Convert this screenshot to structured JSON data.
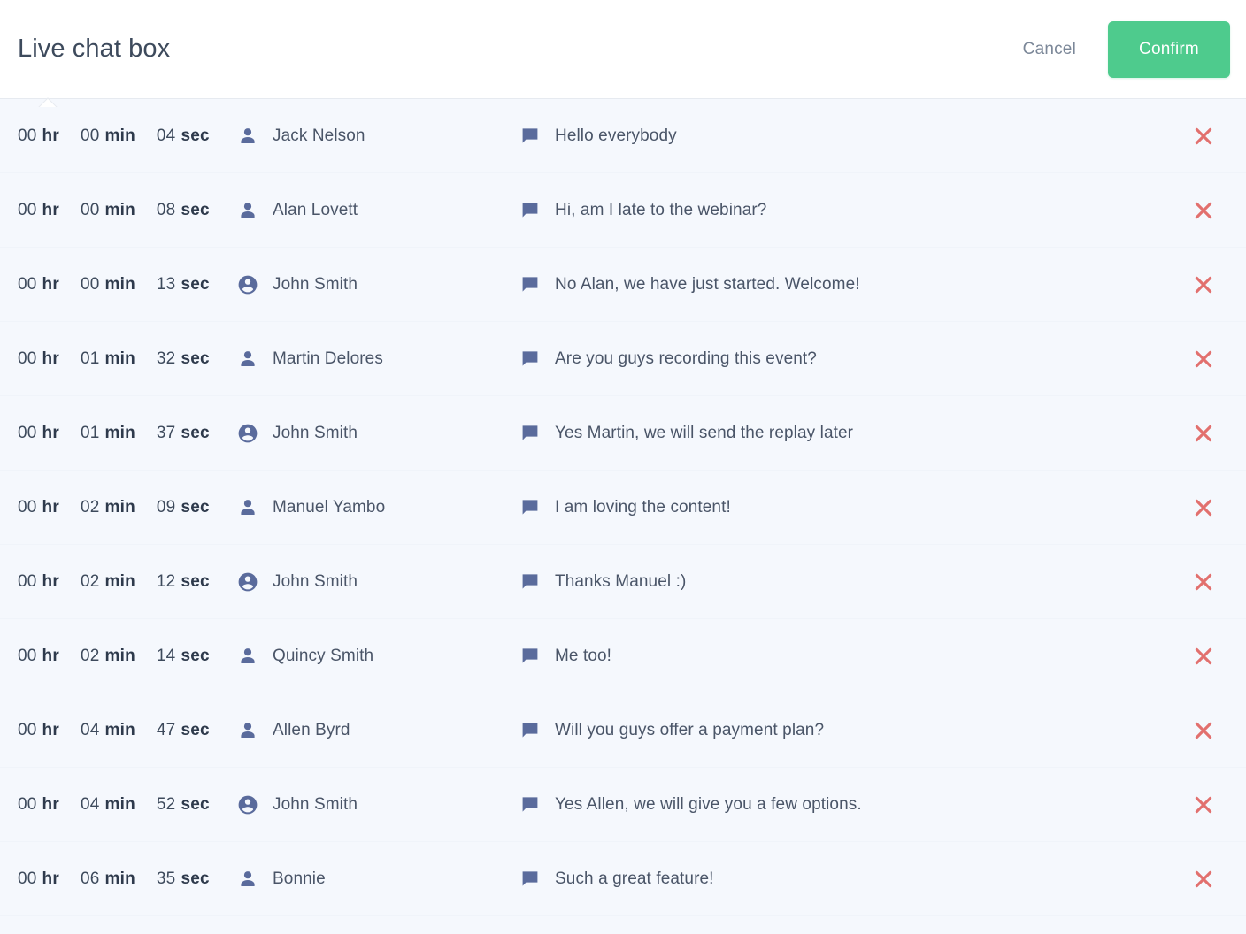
{
  "header": {
    "title": "Live chat box",
    "cancel_label": "Cancel",
    "confirm_label": "Confirm",
    "notch_icon": "caret-up-icon"
  },
  "colors": {
    "confirm_green": "#4ecb8d",
    "delete_red": "#e2706e",
    "icon_slate": "#5a6b9c",
    "text_slate": "#4a5568",
    "title_slate": "#3d4a5c",
    "row_background": "#f5f8fd",
    "header_background": "#ffffff"
  },
  "list": {
    "delete_icon": "close-x-icon",
    "message_icon": "chat-bubble-icon",
    "avatar_guest_icon": "person-icon",
    "avatar_host_icon": "account-circle-icon",
    "units": {
      "hr": "hr",
      "min": "min",
      "sec": "sec"
    },
    "rows": [
      {
        "hours": "00",
        "minutes": "00",
        "seconds": "04",
        "hr_unit": "hr",
        "min_unit": "min",
        "sec_unit": "sec",
        "name": "Jack Nelson",
        "avatar": "person",
        "message": "Hello everybody"
      },
      {
        "hours": "00",
        "minutes": "00",
        "seconds": "08",
        "hr_unit": "hr",
        "min_unit": "min",
        "sec_unit": "sec",
        "name": "Alan Lovett",
        "avatar": "person",
        "message": "Hi, am I late to the webinar?"
      },
      {
        "hours": "00",
        "minutes": "00",
        "seconds": "13",
        "hr_unit": "hr",
        "min_unit": "min",
        "sec_unit": "sec",
        "name": "John Smith",
        "avatar": "account-circle",
        "message": "No Alan, we have just started. Welcome!"
      },
      {
        "hours": "00",
        "minutes": "01",
        "seconds": "32",
        "hr_unit": "hr",
        "min_unit": "min",
        "sec_unit": "sec",
        "name": "Martin Delores",
        "avatar": "person",
        "message": "Are you guys recording this event?"
      },
      {
        "hours": "00",
        "minutes": "01",
        "seconds": "37",
        "hr_unit": "hr",
        "min_unit": "min",
        "sec_unit": "sec",
        "name": "John Smith",
        "avatar": "account-circle",
        "message": "Yes Martin, we will send the replay later"
      },
      {
        "hours": "00",
        "minutes": "02",
        "seconds": "09",
        "hr_unit": "hr",
        "min_unit": "min",
        "sec_unit": "sec",
        "name": "Manuel Yambo",
        "avatar": "person",
        "message": "I am loving the content!"
      },
      {
        "hours": "00",
        "minutes": "02",
        "seconds": "12",
        "hr_unit": "hr",
        "min_unit": "min",
        "sec_unit": "sec",
        "name": "John Smith",
        "avatar": "account-circle",
        "message": "Thanks Manuel :)"
      },
      {
        "hours": "00",
        "minutes": "02",
        "seconds": "14",
        "hr_unit": "hr",
        "min_unit": "min",
        "sec_unit": "sec",
        "name": "Quincy Smith",
        "avatar": "person",
        "message": "Me too!"
      },
      {
        "hours": "00",
        "minutes": "04",
        "seconds": "47",
        "hr_unit": "hr",
        "min_unit": "min",
        "sec_unit": "sec",
        "name": "Allen Byrd",
        "avatar": "person",
        "message": "Will you guys offer a payment plan?"
      },
      {
        "hours": "00",
        "minutes": "04",
        "seconds": "52",
        "hr_unit": "hr",
        "min_unit": "min",
        "sec_unit": "sec",
        "name": "John Smith",
        "avatar": "account-circle",
        "message": "Yes Allen, we will give you a few options."
      },
      {
        "hours": "00",
        "minutes": "06",
        "seconds": "35",
        "hr_unit": "hr",
        "min_unit": "min",
        "sec_unit": "sec",
        "name": "Bonnie",
        "avatar": "person",
        "message": "Such a great feature!"
      }
    ]
  }
}
